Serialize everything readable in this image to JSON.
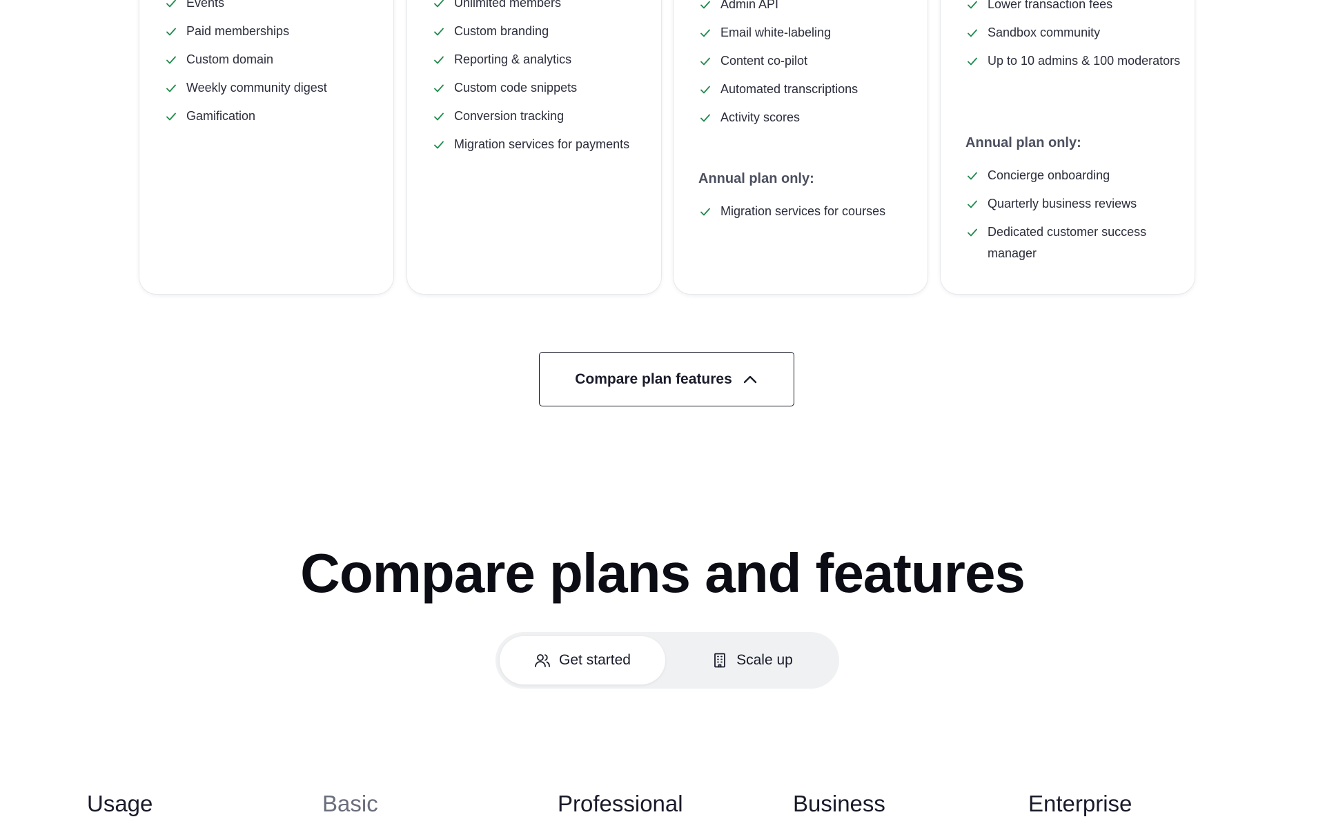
{
  "colors": {
    "check": "#1f8a4c",
    "text_primary": "#191b2a",
    "card_border": "#e6e8ec",
    "toggle_bg": "#f0f1f3",
    "muted": "#6b6f7d"
  },
  "cards": [
    {
      "features": [
        "Events",
        "Paid memberships",
        "Custom domain",
        "Weekly community digest",
        "Gamification"
      ]
    },
    {
      "features": [
        "Unlimited members",
        "Custom branding",
        "Reporting & analytics",
        "Custom code snippets",
        "Conversion tracking",
        "Migration services for payments"
      ]
    },
    {
      "features": [
        "Admin API",
        "Email white-labeling",
        "Content co-pilot",
        "Automated transcriptions",
        "Activity scores"
      ],
      "annual_label": "Annual plan only:",
      "annual_features": [
        "Migration services for courses"
      ]
    },
    {
      "features": [
        "Lower transaction fees",
        "Sandbox community",
        "Up to 10 admins & 100 moderators"
      ],
      "annual_label": "Annual plan only:",
      "annual_features": [
        "Concierge onboarding",
        "Quarterly business reviews",
        "Dedicated customer success manager"
      ]
    }
  ],
  "compare_button": {
    "label": "Compare plan features",
    "icon": "chevron-up-icon"
  },
  "section": {
    "heading": "Compare plans and features"
  },
  "toggle": {
    "options": [
      {
        "label": "Get started",
        "icon": "users-icon",
        "active": true
      },
      {
        "label": "Scale up",
        "icon": "building-icon",
        "active": false
      }
    ]
  },
  "table": {
    "headers": [
      "Usage",
      "Basic",
      "Professional",
      "Business",
      "Enterprise"
    ]
  }
}
